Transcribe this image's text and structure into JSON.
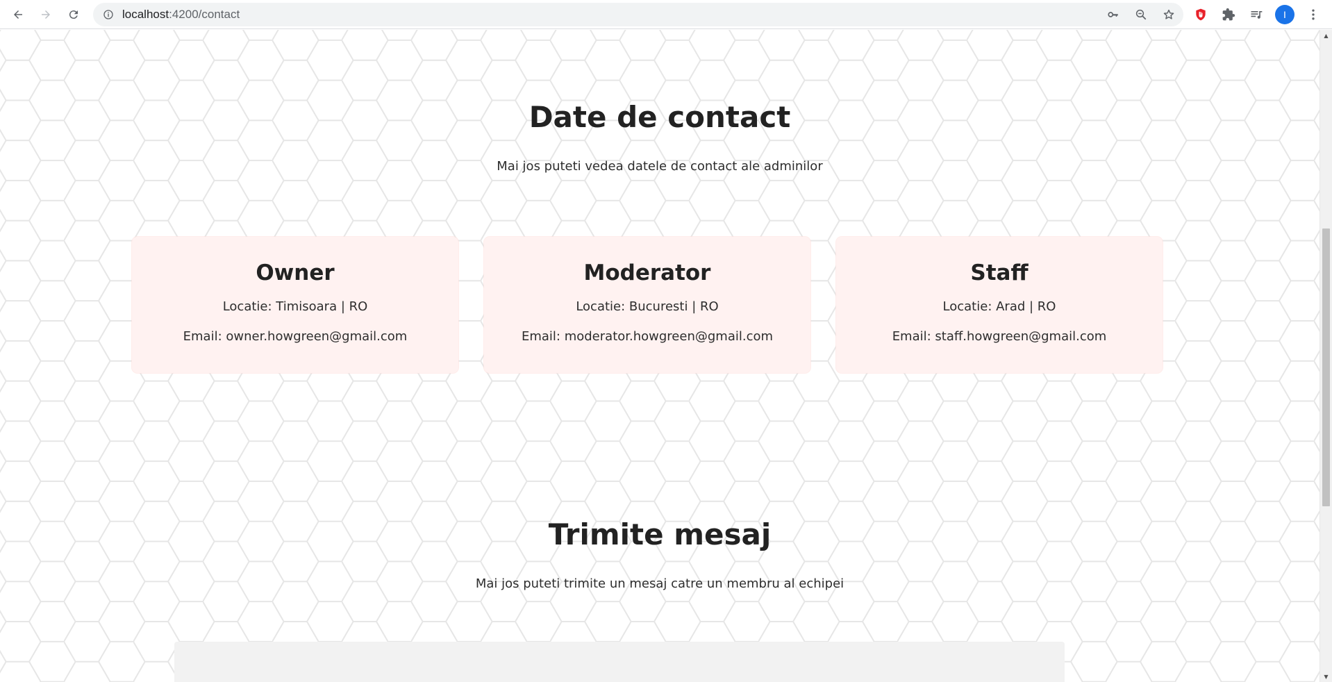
{
  "browser": {
    "url_host": "localhost",
    "url_path": ":4200/contact",
    "avatar_letter": "I"
  },
  "contact_section": {
    "title": "Date de contact",
    "subtitle": "Mai jos puteti vedea datele de contact ale adminilor"
  },
  "cards": [
    {
      "role": "Owner",
      "location": "Locatie: Timisoara | RO",
      "email": "Email: owner.howgreen@gmail.com"
    },
    {
      "role": "Moderator",
      "location": "Locatie: Bucuresti | RO",
      "email": "Email: moderator.howgreen@gmail.com"
    },
    {
      "role": "Staff",
      "location": "Locatie: Arad | RO",
      "email": "Email: staff.howgreen@gmail.com"
    }
  ],
  "message_section": {
    "title": "Trimite mesaj",
    "subtitle": "Mai jos puteti trimite un mesaj catre un membru al echipei"
  },
  "colors": {
    "card_background": "#fff2f1",
    "hex_pattern_stroke": "#e6e6e6",
    "form_background": "#f2f2f2",
    "avatar": "#1a73e8",
    "extension_red": "#e8212a"
  },
  "icons": [
    "back-icon",
    "forward-icon",
    "reload-icon",
    "info-icon",
    "key-icon",
    "zoom-out-icon",
    "star-icon",
    "extension-shield-icon",
    "puzzle-icon",
    "media-queue-icon",
    "kebab-menu-icon"
  ]
}
